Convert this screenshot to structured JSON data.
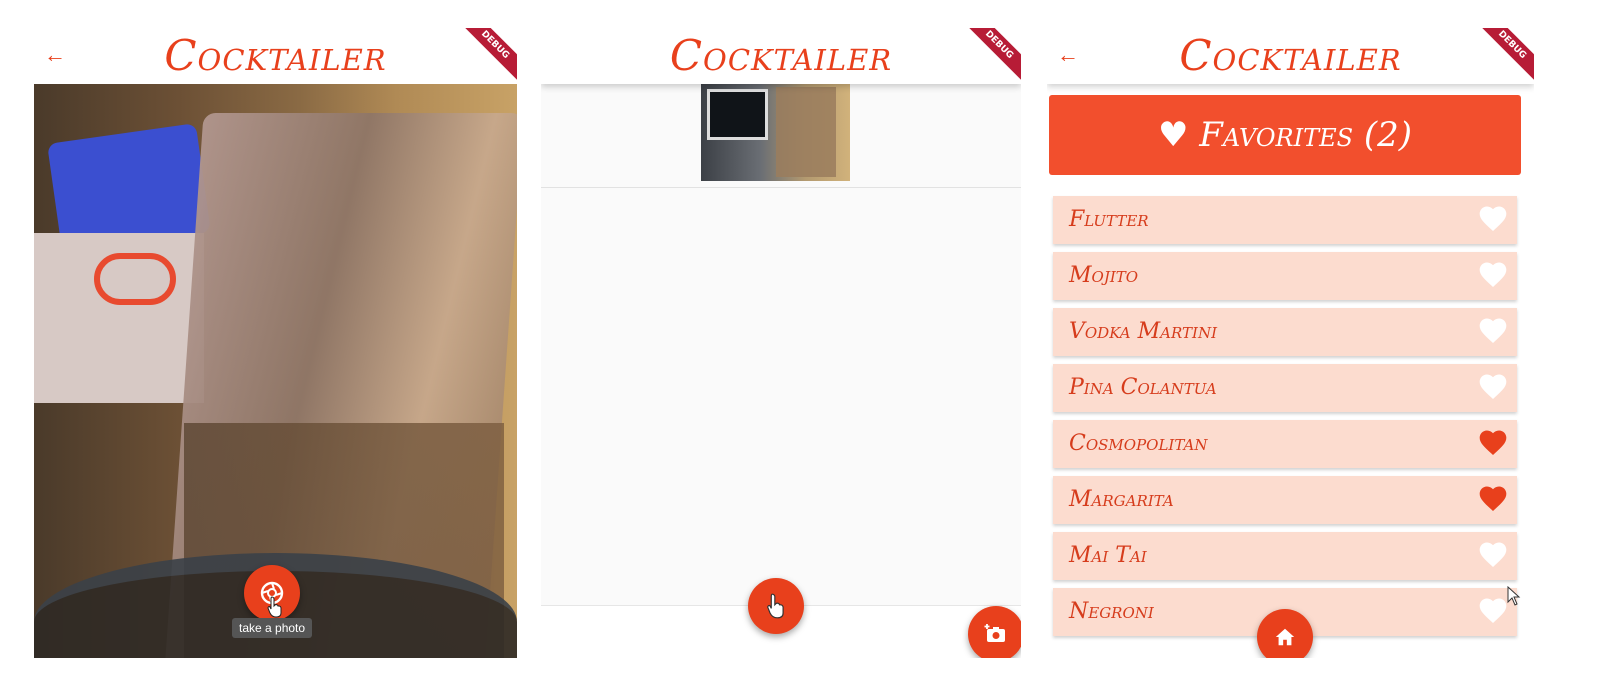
{
  "app": {
    "title": "Cocktailer",
    "debug_label": "DEBUG",
    "accent_color": "#e8401c"
  },
  "screen1": {
    "back_icon": "arrow-left-icon",
    "fab_icon": "camera-shutter-icon",
    "tooltip": "take a photo"
  },
  "screen2": {
    "fab_icon": "hand-pointer-icon",
    "add_photo_icon": "add-a-photo-icon"
  },
  "screen3": {
    "back_icon": "arrow-left-icon",
    "favorites_label": "♥ Favorites (2)",
    "home_icon": "home-icon",
    "cocktails": [
      {
        "name": "Flutter",
        "favorite": false
      },
      {
        "name": "Mojito",
        "favorite": false
      },
      {
        "name": "Vodka Martini",
        "favorite": false
      },
      {
        "name": "Pina Colantua",
        "favorite": false
      },
      {
        "name": "Cosmopolitan",
        "favorite": true
      },
      {
        "name": "Margarita",
        "favorite": true
      },
      {
        "name": "Mai Tai",
        "favorite": false
      },
      {
        "name": "Negroni",
        "favorite": false
      }
    ]
  }
}
